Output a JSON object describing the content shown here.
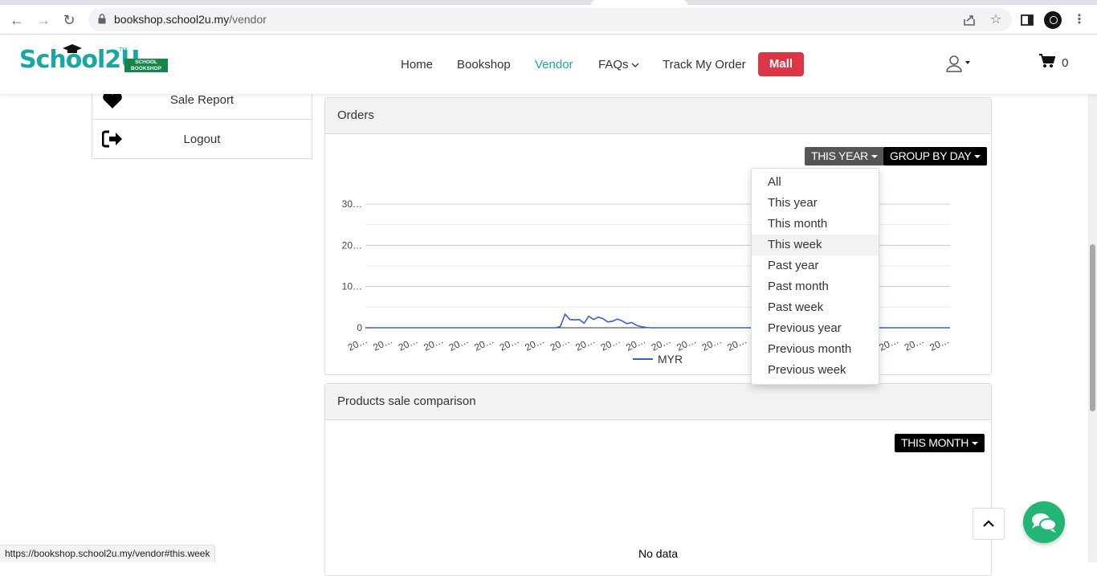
{
  "browser": {
    "url_host": "bookshop.school2u.my",
    "url_path": "/vendor",
    "status_url": "https://bookshop.school2u.my/vendor#this.week"
  },
  "logo": {
    "text": "School2U",
    "tm": "TM",
    "badge_line1": "SCHOOL",
    "badge_line2": "BOOKSHOP"
  },
  "nav": {
    "items": [
      "Home",
      "Bookshop",
      "Vendor",
      "FAQs",
      "Track My Order"
    ],
    "active": "Vendor",
    "mall_label": "Mall",
    "cart_count": "0"
  },
  "sidebar": {
    "items": [
      {
        "label": "Sale Report",
        "icon": "heart-icon"
      },
      {
        "label": "Logout",
        "icon": "sign-out-icon"
      }
    ]
  },
  "orders_panel": {
    "title": "Orders",
    "range_button": "THIS YEAR",
    "group_button": "GROUP BY DAY",
    "range_options": [
      "All",
      "This year",
      "This month",
      "This week",
      "Past year",
      "Past month",
      "Past week",
      "Previous year",
      "Previous month",
      "Previous week"
    ],
    "hovered_option": "This week"
  },
  "products_panel": {
    "title": "Products sale comparison",
    "range_button": "THIS MONTH",
    "empty_text": "No data"
  },
  "colors": {
    "brand_teal": "#1aa7a0",
    "mall_red": "#dc3545",
    "series_blue": "#3b5fc0",
    "chat_green": "#23b575"
  },
  "chart_data": {
    "type": "line",
    "y_tick_labels": [
      "0",
      "10…",
      "20…",
      "30…"
    ],
    "ylim": [
      0,
      30
    ],
    "x_tick_label": "20…",
    "x_tick_count": 24,
    "series": [
      {
        "name": "MYR",
        "values": [
          0,
          0,
          0,
          0,
          0,
          0,
          0,
          0,
          0,
          0,
          0,
          0,
          0,
          0,
          0,
          0,
          0,
          0,
          0,
          0,
          0,
          0,
          0,
          0,
          0,
          0,
          0,
          0,
          0,
          0,
          0,
          0,
          0,
          0,
          0,
          0,
          0,
          0,
          0,
          0,
          0,
          0.3,
          3.3,
          2.0,
          1.9,
          2.0,
          1.1,
          2.8,
          2.0,
          2.6,
          2.2,
          1.4,
          1.6,
          2.1,
          1.7,
          1.0,
          1.3,
          0.6,
          0.3,
          0.1,
          0,
          0,
          0,
          0,
          0,
          0,
          0,
          0,
          0,
          0,
          0,
          0,
          0,
          0,
          0,
          0,
          0,
          0,
          0,
          0,
          0,
          0,
          0,
          0,
          0,
          0,
          0,
          0,
          0,
          0,
          0,
          0,
          0,
          0,
          0,
          0,
          0,
          0,
          0,
          0,
          0,
          0,
          0,
          0,
          0,
          0,
          0,
          0,
          0,
          0,
          0,
          0,
          0,
          0,
          0,
          0,
          0,
          0,
          0,
          0,
          0,
          0,
          0,
          0
        ]
      }
    ],
    "legend": "bottom-center",
    "grid": true
  }
}
